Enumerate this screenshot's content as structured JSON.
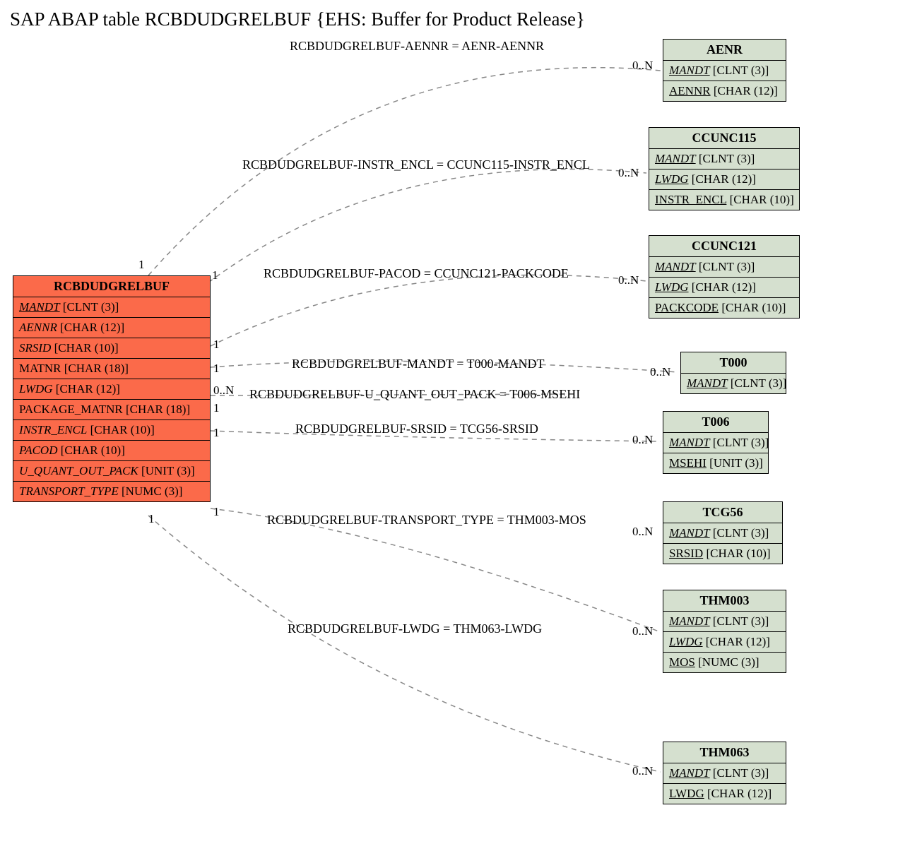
{
  "title": "SAP ABAP table RCBDUDGRELBUF {EHS: Buffer for Product Release}",
  "main_entity": {
    "name": "RCBDUDGRELBUF",
    "fields": [
      {
        "name": "MANDT",
        "type": "[CLNT (3)]",
        "style": "ukey"
      },
      {
        "name": "AENNR",
        "type": "[CHAR (12)]",
        "style": "key"
      },
      {
        "name": "SRSID",
        "type": "[CHAR (10)]",
        "style": "key"
      },
      {
        "name": "MATNR",
        "type": "[CHAR (18)]",
        "style": "plain"
      },
      {
        "name": "LWDG",
        "type": "[CHAR (12)]",
        "style": "key"
      },
      {
        "name": "PACKAGE_MATNR",
        "type": "[CHAR (18)]",
        "style": "plain"
      },
      {
        "name": "INSTR_ENCL",
        "type": "[CHAR (10)]",
        "style": "key"
      },
      {
        "name": "PACOD",
        "type": "[CHAR (10)]",
        "style": "key"
      },
      {
        "name": "U_QUANT_OUT_PACK",
        "type": "[UNIT (3)]",
        "style": "key"
      },
      {
        "name": "TRANSPORT_TYPE",
        "type": "[NUMC (3)]",
        "style": "key"
      }
    ]
  },
  "relations": [
    {
      "label": "RCBDUDGRELBUF-AENNR = AENR-AENNR",
      "card_left": "1",
      "card_right": "0..N"
    },
    {
      "label": "RCBDUDGRELBUF-INSTR_ENCL = CCUNC115-INSTR_ENCL",
      "card_left": "1",
      "card_right": "0..N"
    },
    {
      "label": "RCBDUDGRELBUF-PACOD = CCUNC121-PACKCODE",
      "card_left": "1",
      "card_right": "0..N"
    },
    {
      "label": "RCBDUDGRELBUF-MANDT = T000-MANDT",
      "card_left": "1",
      "card_right": "0..N"
    },
    {
      "label": "RCBDUDGRELBUF-U_QUANT_OUT_PACK = T006-MSEHI",
      "card_left": "0..N",
      "card_right": ""
    },
    {
      "label": "RCBDUDGRELBUF-SRSID = TCG56-SRSID",
      "card_left": "1",
      "card_right": "0..N"
    },
    {
      "label": "RCBDUDGRELBUF-TRANSPORT_TYPE = THM003-MOS",
      "card_left": "1",
      "card_right": "0..N"
    },
    {
      "label": "RCBDUDGRELBUF-LWDG = THM063-LWDG",
      "card_left": "1",
      "card_right": "0..N"
    }
  ],
  "targets": [
    {
      "name": "AENR",
      "fields": [
        {
          "name": "MANDT",
          "type": "[CLNT (3)]",
          "style": "ukey"
        },
        {
          "name": "AENNR",
          "type": "[CHAR (12)]",
          "style": "ul"
        }
      ]
    },
    {
      "name": "CCUNC115",
      "fields": [
        {
          "name": "MANDT",
          "type": "[CLNT (3)]",
          "style": "ukey"
        },
        {
          "name": "LWDG",
          "type": "[CHAR (12)]",
          "style": "ukey"
        },
        {
          "name": "INSTR_ENCL",
          "type": "[CHAR (10)]",
          "style": "ul"
        }
      ]
    },
    {
      "name": "CCUNC121",
      "fields": [
        {
          "name": "MANDT",
          "type": "[CLNT (3)]",
          "style": "ukey"
        },
        {
          "name": "LWDG",
          "type": "[CHAR (12)]",
          "style": "ukey"
        },
        {
          "name": "PACKCODE",
          "type": "[CHAR (10)]",
          "style": "ul"
        }
      ]
    },
    {
      "name": "T000",
      "fields": [
        {
          "name": "MANDT",
          "type": "[CLNT (3)]",
          "style": "ukey"
        }
      ]
    },
    {
      "name": "T006",
      "fields": [
        {
          "name": "MANDT",
          "type": "[CLNT (3)]",
          "style": "ukey"
        },
        {
          "name": "MSEHI",
          "type": "[UNIT (3)]",
          "style": "ul"
        }
      ]
    },
    {
      "name": "TCG56",
      "fields": [
        {
          "name": "MANDT",
          "type": "[CLNT (3)]",
          "style": "ukey"
        },
        {
          "name": "SRSID",
          "type": "[CHAR (10)]",
          "style": "ul"
        }
      ]
    },
    {
      "name": "THM003",
      "fields": [
        {
          "name": "MANDT",
          "type": "[CLNT (3)]",
          "style": "ukey"
        },
        {
          "name": "LWDG",
          "type": "[CHAR (12)]",
          "style": "ukey"
        },
        {
          "name": "MOS",
          "type": "[NUMC (3)]",
          "style": "ul"
        }
      ]
    },
    {
      "name": "THM063",
      "fields": [
        {
          "name": "MANDT",
          "type": "[CLNT (3)]",
          "style": "ukey"
        },
        {
          "name": "LWDG",
          "type": "[CHAR (12)]",
          "style": "ul"
        }
      ]
    }
  ]
}
